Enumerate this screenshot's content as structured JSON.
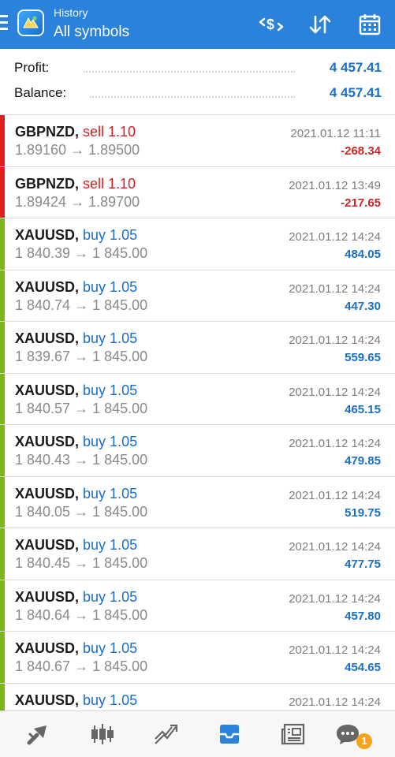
{
  "header": {
    "subtitle": "History",
    "title": "All symbols"
  },
  "colors": {
    "header_bg": "#2a82da",
    "buy": "#1a6fc4",
    "sell": "#d01f1f",
    "buy_bar": "#7cb518",
    "sell_bar": "#e02020",
    "loss": "#c62828",
    "gain": "#1a6fc4"
  },
  "icons": {
    "menu": "hamburger-menu-icon",
    "logo": "metatrader-logo-icon",
    "filter": "dollar-filter-icon",
    "sort": "sort-arrows-icon",
    "calendar": "calendar-icon"
  },
  "summary": {
    "profit_label": "Profit:",
    "profit_value": "4 457.41",
    "balance_label": "Balance:",
    "balance_value": "4 457.41"
  },
  "deals": [
    {
      "symbol": "GBPNZD,",
      "direction": "sell 1.10",
      "type": "sell",
      "prices": "1.89160 → 1.89500",
      "time": "2021.01.12 11:11",
      "profit": "-268.34"
    },
    {
      "symbol": "GBPNZD,",
      "direction": "sell 1.10",
      "type": "sell",
      "prices": "1.89424 → 1.89700",
      "time": "2021.01.12 13:49",
      "profit": "-217.65"
    },
    {
      "symbol": "XAUUSD,",
      "direction": "buy 1.05",
      "type": "buy",
      "prices": "1 840.39 → 1 845.00",
      "time": "2021.01.12 14:24",
      "profit": "484.05"
    },
    {
      "symbol": "XAUUSD,",
      "direction": "buy 1.05",
      "type": "buy",
      "prices": "1 840.74 → 1 845.00",
      "time": "2021.01.12 14:24",
      "profit": "447.30"
    },
    {
      "symbol": "XAUUSD,",
      "direction": "buy 1.05",
      "type": "buy",
      "prices": "1 839.67 → 1 845.00",
      "time": "2021.01.12 14:24",
      "profit": "559.65"
    },
    {
      "symbol": "XAUUSD,",
      "direction": "buy 1.05",
      "type": "buy",
      "prices": "1 840.57 → 1 845.00",
      "time": "2021.01.12 14:24",
      "profit": "465.15"
    },
    {
      "symbol": "XAUUSD,",
      "direction": "buy 1.05",
      "type": "buy",
      "prices": "1 840.43 → 1 845.00",
      "time": "2021.01.12 14:24",
      "profit": "479.85"
    },
    {
      "symbol": "XAUUSD,",
      "direction": "buy 1.05",
      "type": "buy",
      "prices": "1 840.05 → 1 845.00",
      "time": "2021.01.12 14:24",
      "profit": "519.75"
    },
    {
      "symbol": "XAUUSD,",
      "direction": "buy 1.05",
      "type": "buy",
      "prices": "1 840.45 → 1 845.00",
      "time": "2021.01.12 14:24",
      "profit": "477.75"
    },
    {
      "symbol": "XAUUSD,",
      "direction": "buy 1.05",
      "type": "buy",
      "prices": "1 840.64 → 1 845.00",
      "time": "2021.01.12 14:24",
      "profit": "457.80"
    },
    {
      "symbol": "XAUUSD,",
      "direction": "buy 1.05",
      "type": "buy",
      "prices": "1 840.67 → 1 845.00",
      "time": "2021.01.12 14:24",
      "profit": "454.65"
    },
    {
      "symbol": "XAUUSD,",
      "direction": "buy 1.05",
      "type": "buy",
      "prices": "",
      "time": "2021.01.12 14:24",
      "profit": ""
    }
  ],
  "bottom_nav": {
    "items": [
      "quotes-icon",
      "chart-icon",
      "trade-icon",
      "history-icon",
      "news-icon",
      "messages-icon"
    ],
    "active": "history-icon",
    "messages_badge": "1"
  }
}
